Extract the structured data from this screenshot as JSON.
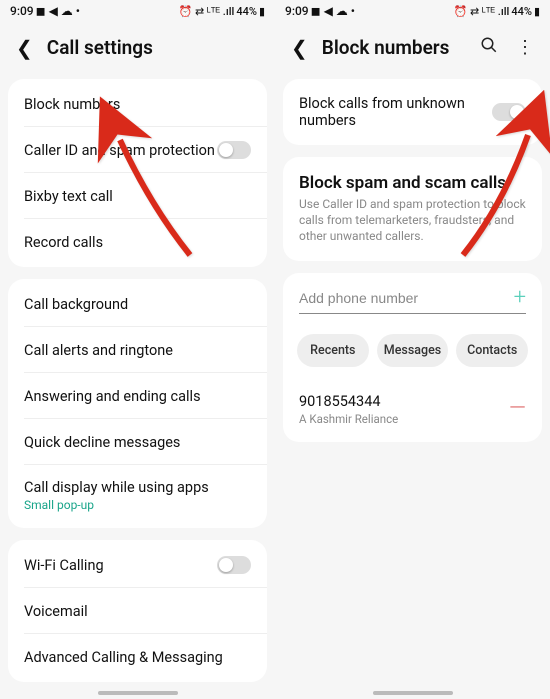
{
  "status": {
    "time": "9:09",
    "icons_left": "◼ ◀ ☁ •",
    "battery": "44%",
    "icons_right": "⏰ ⇄ ᴸᵀᴱ .ıll"
  },
  "screen1": {
    "title": "Call settings",
    "group1": [
      {
        "label": "Block numbers"
      },
      {
        "label": "Caller ID and spam protection",
        "toggle": true
      },
      {
        "label": "Bixby text call"
      },
      {
        "label": "Record calls"
      }
    ],
    "group2": [
      {
        "label": "Call background"
      },
      {
        "label": "Call alerts and ringtone"
      },
      {
        "label": "Answering and ending calls"
      },
      {
        "label": "Quick decline messages"
      },
      {
        "label": "Call display while using apps",
        "sub": "Small pop-up"
      }
    ],
    "group3": [
      {
        "label": "Wi-Fi Calling",
        "toggle": true
      },
      {
        "label": "Voicemail"
      },
      {
        "label": "Advanced Calling & Messaging"
      }
    ]
  },
  "screen2": {
    "title": "Block numbers",
    "block_unknown": "Block calls from unknown numbers",
    "spam_title": "Block spam and scam calls",
    "spam_desc": "Use Caller ID and spam protection to block calls from telemarketers, fraudsters, and other unwanted callers.",
    "add_placeholder": "Add phone number",
    "chips": [
      "Recents",
      "Messages",
      "Contacts"
    ],
    "blocked": {
      "number": "9018554344",
      "carrier": "A Kashmir Reliance"
    }
  },
  "colors": {
    "arrow": "#d92a1a"
  }
}
